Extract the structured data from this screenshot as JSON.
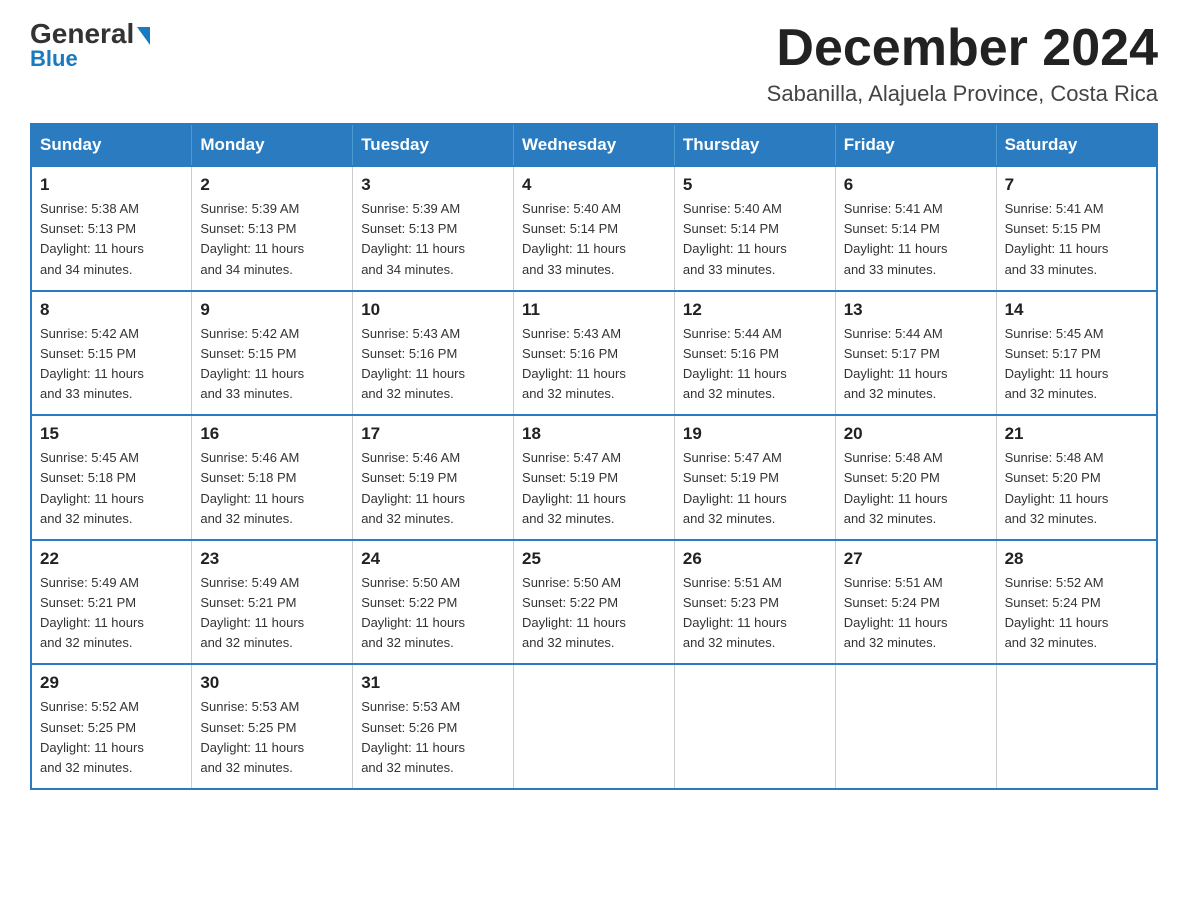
{
  "header": {
    "logo_line1": "General",
    "logo_line2": "Blue",
    "month_title": "December 2024",
    "location": "Sabanilla, Alajuela Province, Costa Rica"
  },
  "weekdays": [
    "Sunday",
    "Monday",
    "Tuesday",
    "Wednesday",
    "Thursday",
    "Friday",
    "Saturday"
  ],
  "weeks": [
    [
      {
        "day": "1",
        "sunrise": "5:38 AM",
        "sunset": "5:13 PM",
        "daylight": "11 hours and 34 minutes."
      },
      {
        "day": "2",
        "sunrise": "5:39 AM",
        "sunset": "5:13 PM",
        "daylight": "11 hours and 34 minutes."
      },
      {
        "day": "3",
        "sunrise": "5:39 AM",
        "sunset": "5:13 PM",
        "daylight": "11 hours and 34 minutes."
      },
      {
        "day": "4",
        "sunrise": "5:40 AM",
        "sunset": "5:14 PM",
        "daylight": "11 hours and 33 minutes."
      },
      {
        "day": "5",
        "sunrise": "5:40 AM",
        "sunset": "5:14 PM",
        "daylight": "11 hours and 33 minutes."
      },
      {
        "day": "6",
        "sunrise": "5:41 AM",
        "sunset": "5:14 PM",
        "daylight": "11 hours and 33 minutes."
      },
      {
        "day": "7",
        "sunrise": "5:41 AM",
        "sunset": "5:15 PM",
        "daylight": "11 hours and 33 minutes."
      }
    ],
    [
      {
        "day": "8",
        "sunrise": "5:42 AM",
        "sunset": "5:15 PM",
        "daylight": "11 hours and 33 minutes."
      },
      {
        "day": "9",
        "sunrise": "5:42 AM",
        "sunset": "5:15 PM",
        "daylight": "11 hours and 33 minutes."
      },
      {
        "day": "10",
        "sunrise": "5:43 AM",
        "sunset": "5:16 PM",
        "daylight": "11 hours and 32 minutes."
      },
      {
        "day": "11",
        "sunrise": "5:43 AM",
        "sunset": "5:16 PM",
        "daylight": "11 hours and 32 minutes."
      },
      {
        "day": "12",
        "sunrise": "5:44 AM",
        "sunset": "5:16 PM",
        "daylight": "11 hours and 32 minutes."
      },
      {
        "day": "13",
        "sunrise": "5:44 AM",
        "sunset": "5:17 PM",
        "daylight": "11 hours and 32 minutes."
      },
      {
        "day": "14",
        "sunrise": "5:45 AM",
        "sunset": "5:17 PM",
        "daylight": "11 hours and 32 minutes."
      }
    ],
    [
      {
        "day": "15",
        "sunrise": "5:45 AM",
        "sunset": "5:18 PM",
        "daylight": "11 hours and 32 minutes."
      },
      {
        "day": "16",
        "sunrise": "5:46 AM",
        "sunset": "5:18 PM",
        "daylight": "11 hours and 32 minutes."
      },
      {
        "day": "17",
        "sunrise": "5:46 AM",
        "sunset": "5:19 PM",
        "daylight": "11 hours and 32 minutes."
      },
      {
        "day": "18",
        "sunrise": "5:47 AM",
        "sunset": "5:19 PM",
        "daylight": "11 hours and 32 minutes."
      },
      {
        "day": "19",
        "sunrise": "5:47 AM",
        "sunset": "5:19 PM",
        "daylight": "11 hours and 32 minutes."
      },
      {
        "day": "20",
        "sunrise": "5:48 AM",
        "sunset": "5:20 PM",
        "daylight": "11 hours and 32 minutes."
      },
      {
        "day": "21",
        "sunrise": "5:48 AM",
        "sunset": "5:20 PM",
        "daylight": "11 hours and 32 minutes."
      }
    ],
    [
      {
        "day": "22",
        "sunrise": "5:49 AM",
        "sunset": "5:21 PM",
        "daylight": "11 hours and 32 minutes."
      },
      {
        "day": "23",
        "sunrise": "5:49 AM",
        "sunset": "5:21 PM",
        "daylight": "11 hours and 32 minutes."
      },
      {
        "day": "24",
        "sunrise": "5:50 AM",
        "sunset": "5:22 PM",
        "daylight": "11 hours and 32 minutes."
      },
      {
        "day": "25",
        "sunrise": "5:50 AM",
        "sunset": "5:22 PM",
        "daylight": "11 hours and 32 minutes."
      },
      {
        "day": "26",
        "sunrise": "5:51 AM",
        "sunset": "5:23 PM",
        "daylight": "11 hours and 32 minutes."
      },
      {
        "day": "27",
        "sunrise": "5:51 AM",
        "sunset": "5:24 PM",
        "daylight": "11 hours and 32 minutes."
      },
      {
        "day": "28",
        "sunrise": "5:52 AM",
        "sunset": "5:24 PM",
        "daylight": "11 hours and 32 minutes."
      }
    ],
    [
      {
        "day": "29",
        "sunrise": "5:52 AM",
        "sunset": "5:25 PM",
        "daylight": "11 hours and 32 minutes."
      },
      {
        "day": "30",
        "sunrise": "5:53 AM",
        "sunset": "5:25 PM",
        "daylight": "11 hours and 32 minutes."
      },
      {
        "day": "31",
        "sunrise": "5:53 AM",
        "sunset": "5:26 PM",
        "daylight": "11 hours and 32 minutes."
      },
      null,
      null,
      null,
      null
    ]
  ],
  "labels": {
    "sunrise": "Sunrise:",
    "sunset": "Sunset:",
    "daylight": "Daylight:"
  }
}
